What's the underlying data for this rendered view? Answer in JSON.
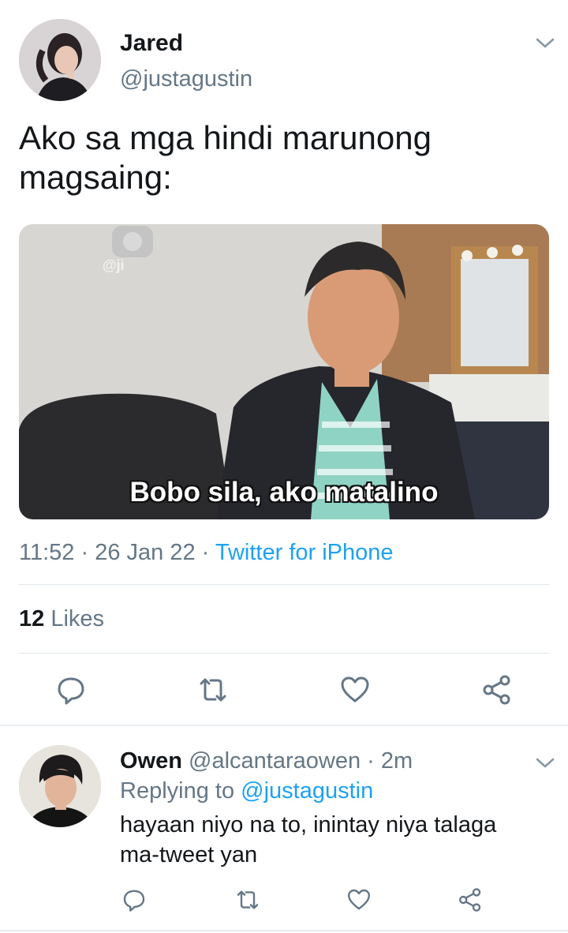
{
  "tweet": {
    "display_name": "Jared",
    "handle": "@justagustin",
    "text_line1": "Ako sa mga hindi marunong",
    "text_line2": "magsaing:",
    "media_caption": "Bobo sila, ako matalino",
    "media_watermark": "@ji",
    "time": "11:52",
    "date": "26 Jan 22",
    "source": "Twitter for iPhone",
    "likes_count": "12",
    "likes_label": "Likes"
  },
  "reply": {
    "display_name": "Owen",
    "handle": "@alcantaraowen",
    "time": "2m",
    "replying_prefix": "Replying to",
    "replying_handle": "@justagustin",
    "text_line1": "hayaan niyo na to, inintay niya talaga",
    "text_line2": "ma-tweet yan"
  },
  "icons": {
    "reply": "reply-icon",
    "retweet": "retweet-icon",
    "like": "heart-icon",
    "share": "share-icon",
    "more": "chevron-down-icon"
  },
  "colors": {
    "link": "#1da1f2",
    "muted": "#657786",
    "text": "#14171a",
    "icon": "#657786"
  }
}
